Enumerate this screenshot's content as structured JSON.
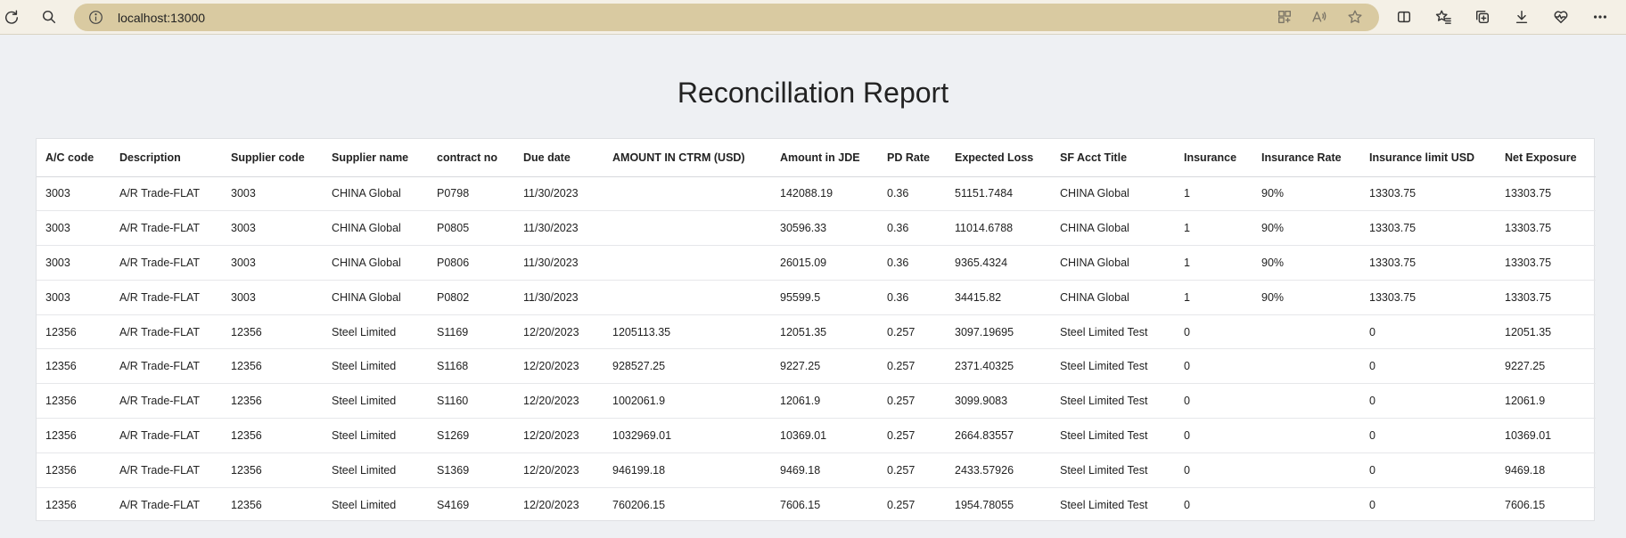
{
  "browser": {
    "url": "localhost:13000"
  },
  "page": {
    "title": "Reconcillation Report"
  },
  "table": {
    "columns": [
      "A/C code",
      "Description",
      "Supplier code",
      "Supplier name",
      "contract no",
      "Due date",
      "AMOUNT IN CTRM (USD)",
      "Amount in JDE",
      "PD Rate",
      "Expected Loss",
      "SF Acct Title",
      "Insurance",
      "Insurance Rate",
      "Insurance limit USD",
      "Net Exposure"
    ],
    "rows": [
      [
        "3003",
        "A/R Trade-FLAT",
        "3003",
        "CHINA Global",
        "P0798",
        "11/30/2023",
        "",
        "142088.19",
        "0.36",
        "51151.7484",
        "CHINA Global",
        "1",
        "90%",
        "13303.75",
        "13303.75"
      ],
      [
        "3003",
        "A/R Trade-FLAT",
        "3003",
        "CHINA Global",
        "P0805",
        "11/30/2023",
        "",
        "30596.33",
        "0.36",
        "11014.6788",
        "CHINA Global",
        "1",
        "90%",
        "13303.75",
        "13303.75"
      ],
      [
        "3003",
        "A/R Trade-FLAT",
        "3003",
        "CHINA Global",
        "P0806",
        "11/30/2023",
        "",
        "26015.09",
        "0.36",
        "9365.4324",
        "CHINA Global",
        "1",
        "90%",
        "13303.75",
        "13303.75"
      ],
      [
        "3003",
        "A/R Trade-FLAT",
        "3003",
        "CHINA Global",
        "P0802",
        "11/30/2023",
        "",
        "95599.5",
        "0.36",
        "34415.82",
        "CHINA Global",
        "1",
        "90%",
        "13303.75",
        "13303.75"
      ],
      [
        "12356",
        "A/R Trade-FLAT",
        "12356",
        "Steel Limited",
        "S1169",
        "12/20/2023",
        "1205113.35",
        "12051.35",
        "0.257",
        "3097.19695",
        "Steel Limited Test",
        "0",
        "",
        "0",
        "12051.35"
      ],
      [
        "12356",
        "A/R Trade-FLAT",
        "12356",
        "Steel Limited",
        "S1168",
        "12/20/2023",
        "928527.25",
        "9227.25",
        "0.257",
        "2371.40325",
        "Steel Limited Test",
        "0",
        "",
        "0",
        "9227.25"
      ],
      [
        "12356",
        "A/R Trade-FLAT",
        "12356",
        "Steel Limited",
        "S1160",
        "12/20/2023",
        "1002061.9",
        "12061.9",
        "0.257",
        "3099.9083",
        "Steel Limited Test",
        "0",
        "",
        "0",
        "12061.9"
      ],
      [
        "12356",
        "A/R Trade-FLAT",
        "12356",
        "Steel Limited",
        "S1269",
        "12/20/2023",
        "1032969.01",
        "10369.01",
        "0.257",
        "2664.83557",
        "Steel Limited Test",
        "0",
        "",
        "0",
        "10369.01"
      ],
      [
        "12356",
        "A/R Trade-FLAT",
        "12356",
        "Steel Limited",
        "S1369",
        "12/20/2023",
        "946199.18",
        "9469.18",
        "0.257",
        "2433.57926",
        "Steel Limited Test",
        "0",
        "",
        "0",
        "9469.18"
      ],
      [
        "12356",
        "A/R Trade-FLAT",
        "12356",
        "Steel Limited",
        "S4169",
        "12/20/2023",
        "760206.15",
        "7606.15",
        "0.257",
        "1954.78055",
        "Steel Limited Test",
        "0",
        "",
        "0",
        "7606.15"
      ]
    ]
  },
  "icons": {
    "reload": "reload-icon",
    "search": "search-icon",
    "site_info": "info-icon",
    "app_available": "app-available-icon",
    "read_aloud": "read-aloud-icon",
    "favorite": "star-icon",
    "split_screen": "split-screen-icon",
    "favorites": "favorites-icon",
    "collections": "collections-icon",
    "downloads": "download-icon",
    "browser_essentials": "heart-pulse-icon",
    "more": "more-icon"
  }
}
